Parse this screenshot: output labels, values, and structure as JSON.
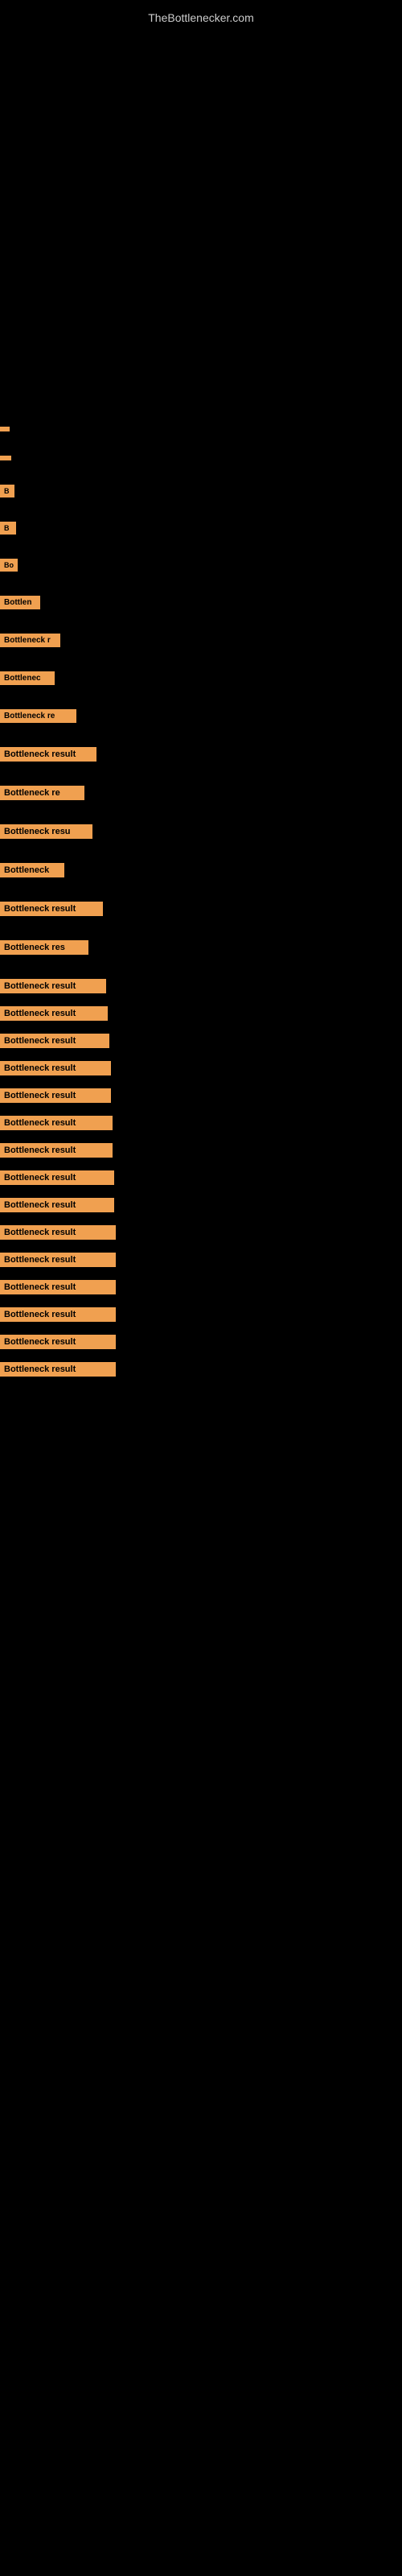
{
  "site": {
    "title": "TheBottlenecker.com"
  },
  "items": [
    {
      "id": 1,
      "label": "",
      "visible_text": ""
    },
    {
      "id": 2,
      "label": "",
      "visible_text": ""
    },
    {
      "id": 3,
      "label": "B",
      "visible_text": "B"
    },
    {
      "id": 4,
      "label": "B",
      "visible_text": "B"
    },
    {
      "id": 5,
      "label": "Bo",
      "visible_text": "Bo"
    },
    {
      "id": 6,
      "label": "Bottlen",
      "visible_text": "Bottlen"
    },
    {
      "id": 7,
      "label": "Bottleneck r",
      "visible_text": "Bottleneck r"
    },
    {
      "id": 8,
      "label": "Bottlenec",
      "visible_text": "Bottlenec"
    },
    {
      "id": 9,
      "label": "Bottleneck re",
      "visible_text": "Bottleneck re"
    },
    {
      "id": 10,
      "label": "Bottleneck result",
      "visible_text": "Bottleneck result"
    },
    {
      "id": 11,
      "label": "Bottleneck re",
      "visible_text": "Bottleneck re"
    },
    {
      "id": 12,
      "label": "Bottleneck resu",
      "visible_text": "Bottleneck resu"
    },
    {
      "id": 13,
      "label": "Bottleneck",
      "visible_text": "Bottleneck"
    },
    {
      "id": 14,
      "label": "Bottleneck result",
      "visible_text": "Bottleneck result"
    },
    {
      "id": 15,
      "label": "Bottleneck res",
      "visible_text": "Bottleneck res"
    },
    {
      "id": 16,
      "label": "Bottleneck result",
      "visible_text": "Bottleneck result"
    },
    {
      "id": 17,
      "label": "Bottleneck result",
      "visible_text": "Bottleneck result"
    },
    {
      "id": 18,
      "label": "Bottleneck result",
      "visible_text": "Bottleneck result"
    },
    {
      "id": 19,
      "label": "Bottleneck result",
      "visible_text": "Bottleneck result"
    },
    {
      "id": 20,
      "label": "Bottleneck result",
      "visible_text": "Bottleneck result"
    },
    {
      "id": 21,
      "label": "Bottleneck result",
      "visible_text": "Bottleneck result"
    },
    {
      "id": 22,
      "label": "Bottleneck result",
      "visible_text": "Bottleneck result"
    },
    {
      "id": 23,
      "label": "Bottleneck result",
      "visible_text": "Bottleneck result"
    },
    {
      "id": 24,
      "label": "Bottleneck result",
      "visible_text": "Bottleneck result"
    },
    {
      "id": 25,
      "label": "Bottleneck result",
      "visible_text": "Bottleneck result"
    },
    {
      "id": 26,
      "label": "Bottleneck result",
      "visible_text": "Bottleneck result"
    },
    {
      "id": 27,
      "label": "Bottleneck result",
      "visible_text": "Bottleneck result"
    },
    {
      "id": 28,
      "label": "Bottleneck result",
      "visible_text": "Bottleneck result"
    },
    {
      "id": 29,
      "label": "Bottleneck result",
      "visible_text": "Bottleneck result"
    },
    {
      "id": 30,
      "label": "Bottleneck result",
      "visible_text": "Bottleneck result"
    }
  ]
}
